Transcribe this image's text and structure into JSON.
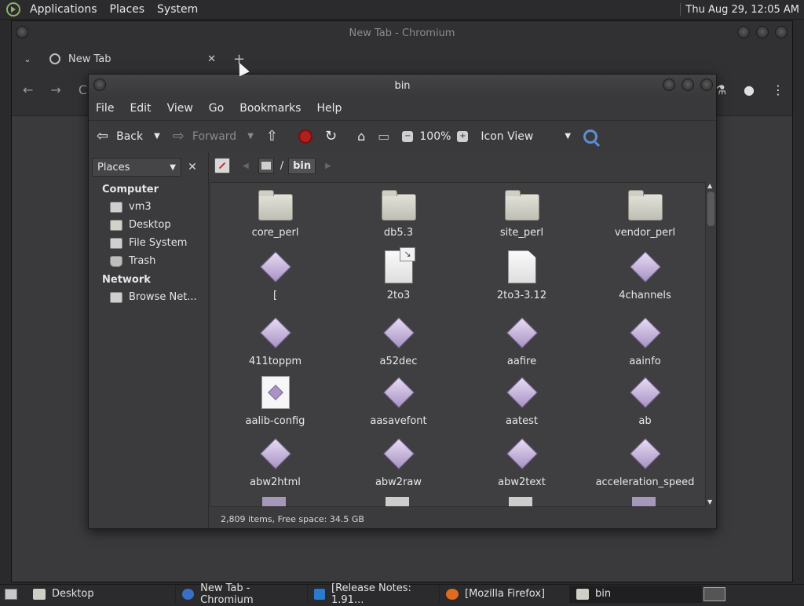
{
  "top_panel": {
    "menus": [
      "Applications",
      "Places",
      "System"
    ],
    "clock": "Thu Aug 29, 12:05 AM"
  },
  "chromium": {
    "window_title": "New Tab - Chromium",
    "tab_title": "New Tab",
    "tab_close": "✕",
    "new_tab": "+",
    "tab_dropdown": "⌄",
    "nav": {
      "back": "←",
      "forward": "→",
      "reload": "C"
    },
    "toolbar_right": {
      "labs": "⚗",
      "profile": "●",
      "menu": "⋮"
    }
  },
  "caja": {
    "window_title": "bin",
    "menu": [
      "File",
      "Edit",
      "View",
      "Go",
      "Bookmarks",
      "Help"
    ],
    "toolbar": {
      "back": "Back",
      "forward": "Forward",
      "zoom": "100%",
      "view_mode": "Icon View"
    },
    "sidebar": {
      "combo": "Places",
      "close": "✕",
      "computer_heading": "Computer",
      "computer_items": [
        "vm3",
        "Desktop",
        "File System",
        "Trash"
      ],
      "network_heading": "Network",
      "network_items": [
        "Browse Net..."
      ]
    },
    "path": {
      "separator": "/",
      "current": "bin"
    },
    "files": [
      {
        "name": "core_perl",
        "type": "folder"
      },
      {
        "name": "db5.3",
        "type": "folder"
      },
      {
        "name": "site_perl",
        "type": "folder"
      },
      {
        "name": "vendor_perl",
        "type": "folder"
      },
      {
        "name": "[",
        "type": "exec"
      },
      {
        "name": "2to3",
        "type": "link"
      },
      {
        "name": "2to3-3.12",
        "type": "doc"
      },
      {
        "name": "4channels",
        "type": "exec"
      },
      {
        "name": "411toppm",
        "type": "exec"
      },
      {
        "name": "a52dec",
        "type": "exec"
      },
      {
        "name": "aafire",
        "type": "exec"
      },
      {
        "name": "aainfo",
        "type": "exec"
      },
      {
        "name": "aalib-config",
        "type": "script"
      },
      {
        "name": "aasavefont",
        "type": "exec"
      },
      {
        "name": "aatest",
        "type": "exec"
      },
      {
        "name": "ab",
        "type": "exec"
      },
      {
        "name": "abw2html",
        "type": "exec"
      },
      {
        "name": "abw2raw",
        "type": "exec"
      },
      {
        "name": "abw2text",
        "type": "exec"
      },
      {
        "name": "acceleration_speed",
        "type": "exec"
      }
    ],
    "status": "2,809 items, Free space: 34.5 GB"
  },
  "taskbar": {
    "items": [
      {
        "label": "Desktop",
        "icon": "folder-icon"
      },
      {
        "label": "New Tab - Chromium",
        "icon": "chromium-icon"
      },
      {
        "label": "[Release Notes: 1.91...",
        "icon": "vscode-icon"
      },
      {
        "label": "[Mozilla Firefox]",
        "icon": "firefox-icon"
      },
      {
        "label": "bin",
        "icon": "folder-icon"
      }
    ]
  }
}
